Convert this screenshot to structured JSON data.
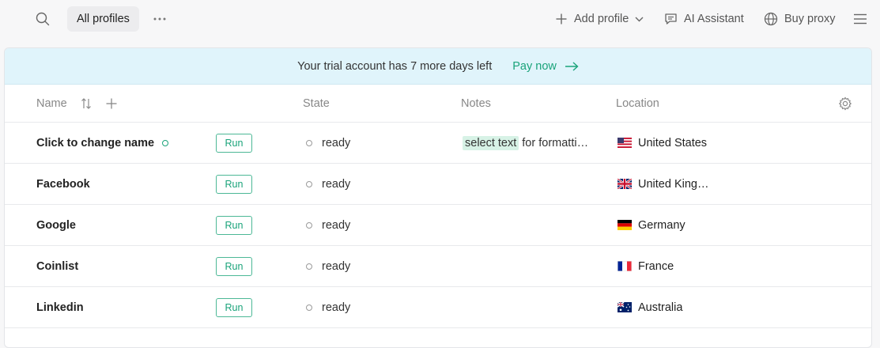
{
  "topbar": {
    "search_icon": "search-icon",
    "tab_label": "All profiles",
    "more_icon": "ellipsis-icon",
    "add_profile_label": "Add profile",
    "ai_assistant_label": "AI Assistant",
    "buy_proxy_label": "Buy proxy",
    "menu_icon": "hamburger-icon"
  },
  "banner": {
    "message": "Your trial account has 7 more days left",
    "action_label": "Pay now"
  },
  "table": {
    "columns": {
      "name": "Name",
      "state": "State",
      "notes": "Notes",
      "location": "Location"
    },
    "rows": [
      {
        "name": "Click to change name",
        "run_label": "Run",
        "state": "ready",
        "notes_highlight": "select text",
        "notes_rest": "for formatti…",
        "location": "United States",
        "flag": "us"
      },
      {
        "name": "Facebook",
        "run_label": "Run",
        "state": "ready",
        "notes_highlight": "",
        "notes_rest": "",
        "location": "United King…",
        "flag": "gb"
      },
      {
        "name": "Google",
        "run_label": "Run",
        "state": "ready",
        "notes_highlight": "",
        "notes_rest": "",
        "location": "Germany",
        "flag": "de"
      },
      {
        "name": "Coinlist",
        "run_label": "Run",
        "state": "ready",
        "notes_highlight": "",
        "notes_rest": "",
        "location": "France",
        "flag": "fr"
      },
      {
        "name": "Linkedin",
        "run_label": "Run",
        "state": "ready",
        "notes_highlight": "",
        "notes_rest": "",
        "location": "Australia",
        "flag": "au"
      }
    ]
  },
  "colors": {
    "accent": "#1aa37a",
    "banner_bg": "#e0f4fb",
    "highlight_bg": "#d7f2e6"
  }
}
